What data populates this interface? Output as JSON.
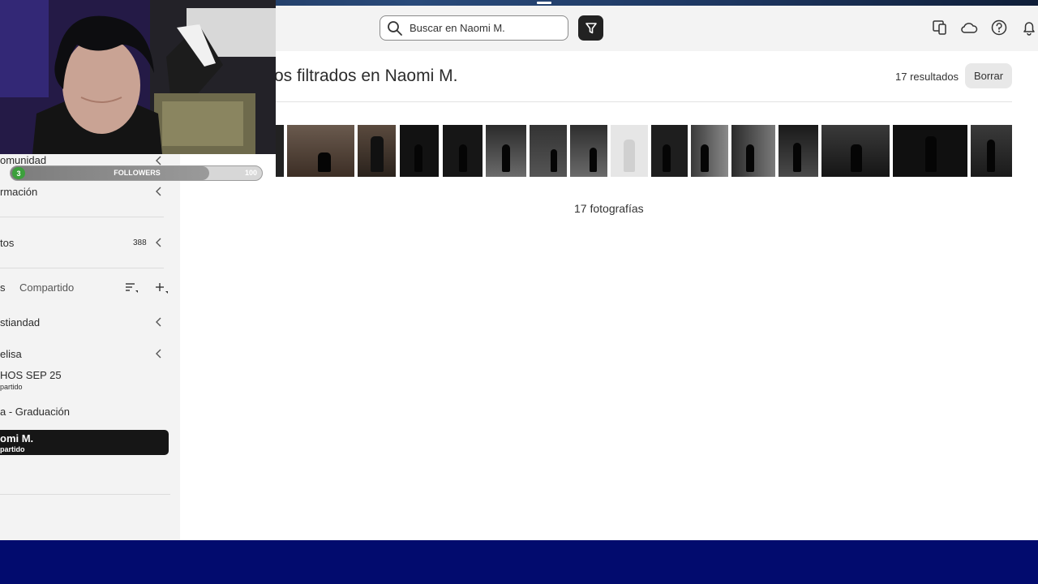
{
  "search": {
    "placeholder": "Buscar en Naomi M."
  },
  "header": {
    "title": "os filtrados en Naomi M.",
    "results": "17 resultados",
    "clear_label": "Borrar"
  },
  "gallery": {
    "count_label": "17 fotografías",
    "photo_count": 17
  },
  "sidebar": {
    "comunidad": "omunidad",
    "informacion": "rmación",
    "fotos": {
      "label": "tos",
      "count": "388"
    },
    "tabs": {
      "left_partial": "s",
      "shared": "Compartido"
    },
    "albums": [
      {
        "label": "stiandad"
      },
      {
        "label": "elisa"
      },
      {
        "label": "HOS SEP 25",
        "sub": "partido"
      },
      {
        "label": "a - Graduación"
      },
      {
        "label": "omi M.",
        "sub": "partido"
      }
    ]
  },
  "stream_overlay": {
    "badge": "3",
    "label": "FOLLOWERS",
    "goal": "100",
    "progress": 0.79
  },
  "colors": {
    "accent_dark": "#161616",
    "bottom_bar": "#020b6e",
    "badge_green": "#3ca03c"
  },
  "icons": [
    "search-icon",
    "filter-icon",
    "devices-icon",
    "cloud-icon",
    "help-icon",
    "bell-icon",
    "chevron-left-icon",
    "sort-icon",
    "add-icon"
  ]
}
